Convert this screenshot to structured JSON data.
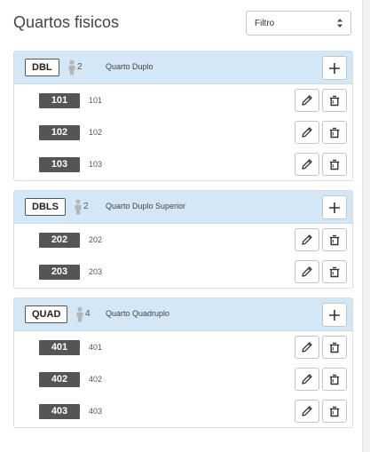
{
  "header": {
    "title": "Quartos fisicos",
    "filter": {
      "selected": "Filtro"
    }
  },
  "groups": [
    {
      "code": "DBL",
      "capacity": "2",
      "name": "Quarto Duplo",
      "rooms": [
        {
          "number": "101",
          "name": "101"
        },
        {
          "number": "102",
          "name": "102"
        },
        {
          "number": "103",
          "name": "103"
        }
      ]
    },
    {
      "code": "DBLS",
      "capacity": "2",
      "name": "Quarto Duplo Superior",
      "rooms": [
        {
          "number": "202",
          "name": "202"
        },
        {
          "number": "203",
          "name": "203"
        }
      ]
    },
    {
      "code": "QUAD",
      "capacity": "4",
      "name": "Quarto Quadruplo",
      "rooms": [
        {
          "number": "401",
          "name": "401"
        },
        {
          "number": "402",
          "name": "402"
        },
        {
          "number": "403",
          "name": "403"
        }
      ]
    }
  ],
  "icons": {
    "person": "person-icon",
    "add": "plus-icon",
    "edit": "pencil-icon",
    "delete": "trash-icon",
    "select_arrows": "updown-arrows-icon"
  },
  "colors": {
    "group_header_bg": "#d4e7f7",
    "room_badge_bg": "#555555",
    "border": "#d9dde1"
  }
}
